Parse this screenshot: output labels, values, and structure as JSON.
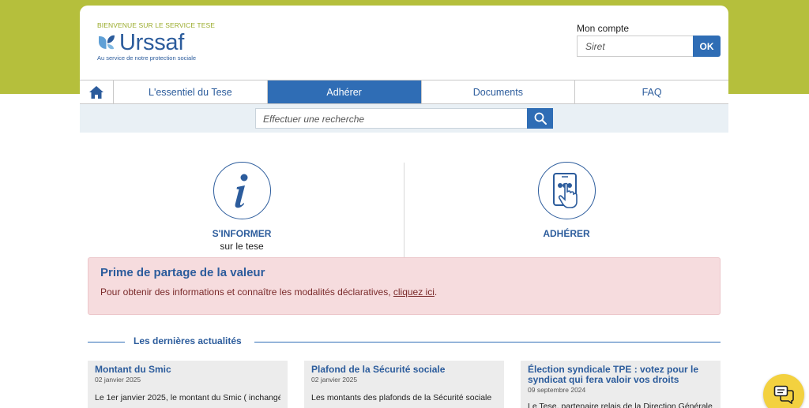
{
  "header": {
    "welcome": "BIENVENUE SUR LE SERVICE TESE",
    "logo_text": "Urssaf",
    "tagline": "Au service de notre protection sociale",
    "account": {
      "label": "Mon compte",
      "siret_placeholder": "Siret",
      "ok_label": "OK"
    }
  },
  "nav": {
    "home_icon": "home-icon",
    "items": [
      {
        "label": "L'essentiel du Tese",
        "active": false
      },
      {
        "label": "Adhérer",
        "active": true
      },
      {
        "label": "Documents",
        "active": false
      },
      {
        "label": "FAQ",
        "active": false
      }
    ]
  },
  "search": {
    "placeholder": "Effectuer une recherche",
    "icon": "search-icon"
  },
  "features": [
    {
      "title": "S'INFORMER",
      "subtitle": "sur le tese",
      "icon": "info-icon"
    },
    {
      "title": "ADHÉRER",
      "subtitle": "",
      "icon": "tablet-touch-icon"
    }
  ],
  "alert": {
    "title": "Prime de partage de la valeur",
    "text": "Pour obtenir des informations et connaître les modalités déclaratives, ",
    "link": "cliquez ici",
    "suffix": "."
  },
  "news": {
    "heading": "Les dernières actualités",
    "items": [
      {
        "title": "Montant du Smic",
        "date": "02 janvier 2025",
        "excerpt": "Le 1er janvier 2025, le montant du Smic ( inchangé"
      },
      {
        "title": "Plafond de la Sécurité sociale",
        "date": "02 janvier 2025",
        "excerpt": "Les montants des plafonds de la Sécurité sociale"
      },
      {
        "title": "Élection syndicale TPE : votez pour le syndicat qui fera valoir vos droits",
        "date": "09 septembre 2024",
        "excerpt": "Le Tese, partenaire relais de la Direction Générale"
      }
    ]
  },
  "chat": {
    "icon": "chat-icon"
  },
  "colors": {
    "brand_blue": "#2f6db5",
    "band_green": "#b5bf3c",
    "alert_bg": "#f6dcde",
    "chat_yellow": "#f3d13f"
  }
}
